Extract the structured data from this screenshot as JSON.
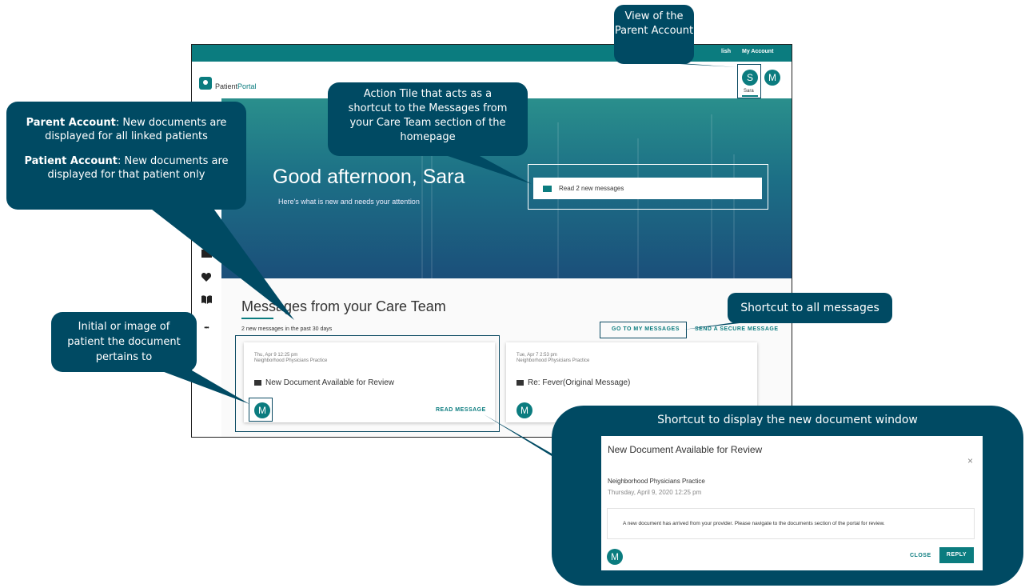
{
  "portal": {
    "brand_a": "Patient",
    "brand_b": "Portal",
    "topbar_links": [
      "lish",
      "My Account"
    ],
    "avatars": [
      {
        "letter": "S",
        "name": "Sara"
      },
      {
        "letter": "M"
      }
    ],
    "greeting": "Good afternoon, Sara",
    "subgreeting": "Here's what is new and needs your attention",
    "action_tile": "Read 2 new messages",
    "sidebar_icons": [
      "folder-icon",
      "heart-icon",
      "book-icon",
      "more-icon"
    ],
    "more_glyph": "•••"
  },
  "messages": {
    "title": "Messages from your Care Team",
    "count_text": "2 new messages in the past 30 days",
    "go_to_label": "GO TO MY MESSAGES",
    "send_label": "SEND A SECURE MESSAGE",
    "cards": [
      {
        "date": "Thu, Apr 9 12:25 pm",
        "practice": "Neighborhood Physicians Practice",
        "subject": "New Document Available for Review",
        "avatar": "M",
        "action": "READ MESSAGE"
      },
      {
        "date": "Tue, Apr 7 2:53 pm",
        "practice": "Neighborhood Physicians Practice",
        "subject": "Re: Fever(Original Message)",
        "avatar": "M"
      }
    ]
  },
  "callouts": {
    "parent_view": "View of the Parent Account",
    "action_tile": "Action Tile that acts as a shortcut to the Messages from your Care Team section of the homepage",
    "parent_account_label": "Parent Account",
    "parent_account_text": ": New documents are displayed for all linked patients",
    "patient_account_label": "Patient Account",
    "patient_account_text": ": New documents are displayed for that patient only",
    "shortcut_all": "Shortcut to all messages",
    "initial": "Initial or image of patient the document pertains to",
    "shortcut_doc": "Shortcut to display the new document window"
  },
  "modal": {
    "title": "New Document Available for Review",
    "practice": "Neighborhood Physicians Practice",
    "date": "Thursday, April 9, 2020 12:25 pm",
    "body": "A new document has arrived from your provider. Please navigate to the documents section of the portal for review.",
    "avatar": "M",
    "close_label": "CLOSE",
    "reply_label": "REPLY",
    "close_glyph": "×"
  },
  "colors": {
    "teal": "#0b7c7f",
    "callout": "#004a63"
  }
}
